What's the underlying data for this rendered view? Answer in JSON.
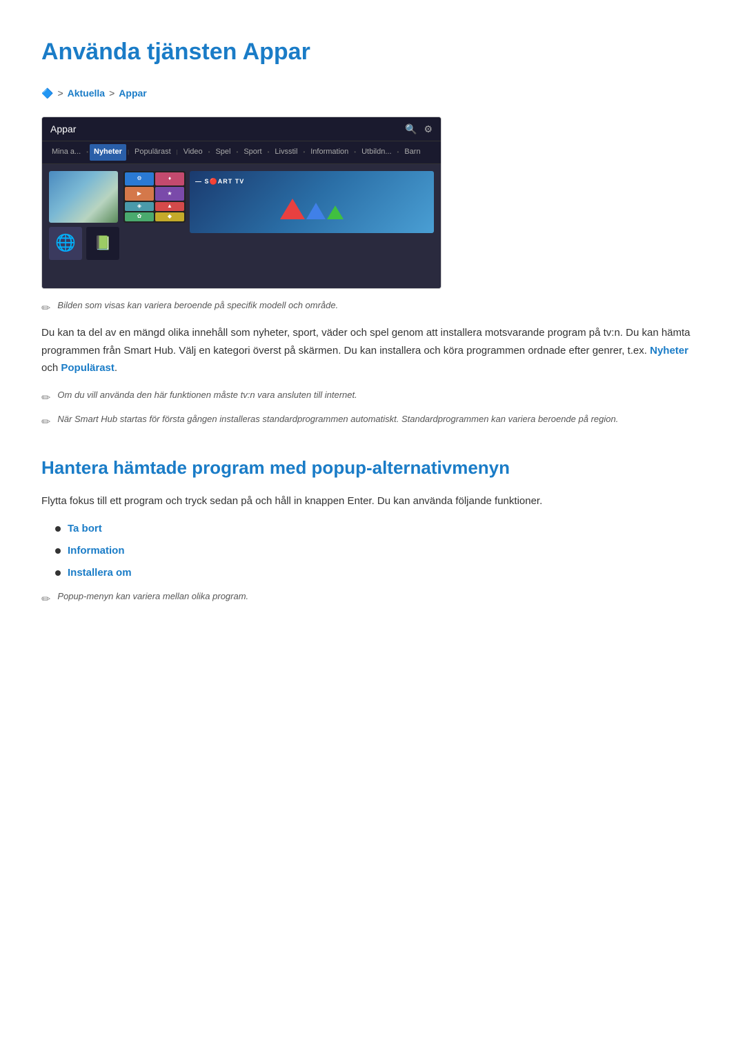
{
  "page": {
    "title": "Använda tjänsten Appar",
    "breadcrumb": {
      "icon": "🔷",
      "separator": ">",
      "item1": "Aktuella",
      "item2": "Appar"
    },
    "tv_ui": {
      "header_title": "Appar",
      "nav_items": [
        "Mina a...",
        "Nyheter",
        "Populärast",
        "Video",
        "Spel",
        "Sport",
        "Livsstil",
        "Information",
        "Utbildn...",
        "Barn"
      ],
      "nav_active": "Nyheter"
    },
    "image_note": "Bilden som visas kan variera beroende på specifik modell och område.",
    "body_paragraph": "Du kan ta del av en mängd olika innehåll som nyheter, sport, väder och spel genom att installera motsvarande program på tv:n. Du kan hämta programmen från Smart Hub. Välj en kategori överst på skärmen. Du kan installera och köra programmen ordnade efter genrer, t.ex.",
    "body_link1": "Nyheter",
    "body_connector": "och",
    "body_link2": "Populärast",
    "body_end": ".",
    "note1": "Om du vill använda den här funktionen måste tv:n vara ansluten till internet.",
    "note2": "När Smart Hub startas för första gången installeras standardprogrammen automatiskt. Standardprogrammen kan variera beroende på region.",
    "section2_title": "Hantera hämtade program med popup-alternativmenyn",
    "section2_intro": "Flytta fokus till ett program och tryck sedan på och håll in knappen Enter. Du kan använda följande funktioner.",
    "bullet_items": [
      {
        "label": "Ta bort"
      },
      {
        "label": "Information"
      },
      {
        "label": "Installera om"
      }
    ],
    "note3": "Popup-menyn kan variera mellan olika program."
  }
}
